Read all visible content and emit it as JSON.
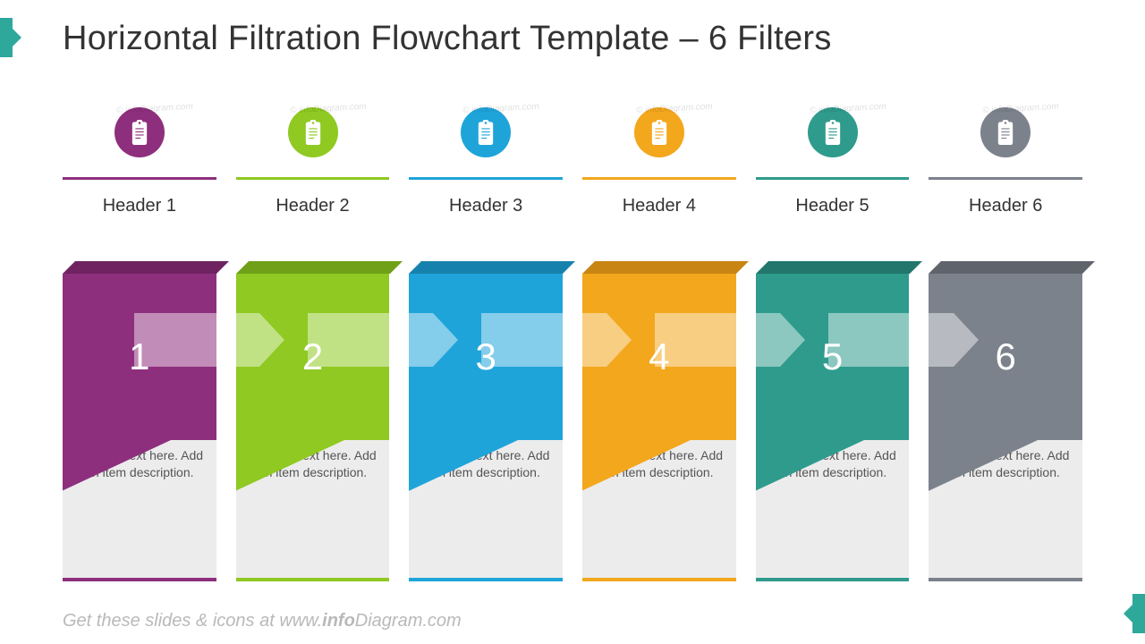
{
  "title": "Horizontal Filtration Flowchart Template – 6 Filters",
  "footer_prefix": "Get these slides & icons at www.",
  "footer_bold": "info",
  "footer_suffix": "Diagram.com",
  "watermark": "© infoDiagram.com",
  "filters": [
    {
      "num": "1",
      "header": "Header 1",
      "desc": "Put your text here. Add an item description.",
      "color": "#8e2f7d",
      "dark": "#6f2361"
    },
    {
      "num": "2",
      "header": "Header 2",
      "desc": "Put your text here. Add an item description.",
      "color": "#8fc922",
      "dark": "#6fa018"
    },
    {
      "num": "3",
      "header": "Header 3",
      "desc": "Put your text here. Add an item description.",
      "color": "#1fa4da",
      "dark": "#1781ad"
    },
    {
      "num": "4",
      "header": "Header 4",
      "desc": "Put your text here. Add an item description.",
      "color": "#f3a71d",
      "dark": "#c98513"
    },
    {
      "num": "5",
      "header": "Header 5",
      "desc": "Put your text here. Add an item description.",
      "color": "#2f9b8d",
      "dark": "#22766b"
    },
    {
      "num": "6",
      "header": "Header 6",
      "desc": "Put your text here. Add an item description.",
      "color": "#7c828c",
      "dark": "#5f646c"
    }
  ]
}
